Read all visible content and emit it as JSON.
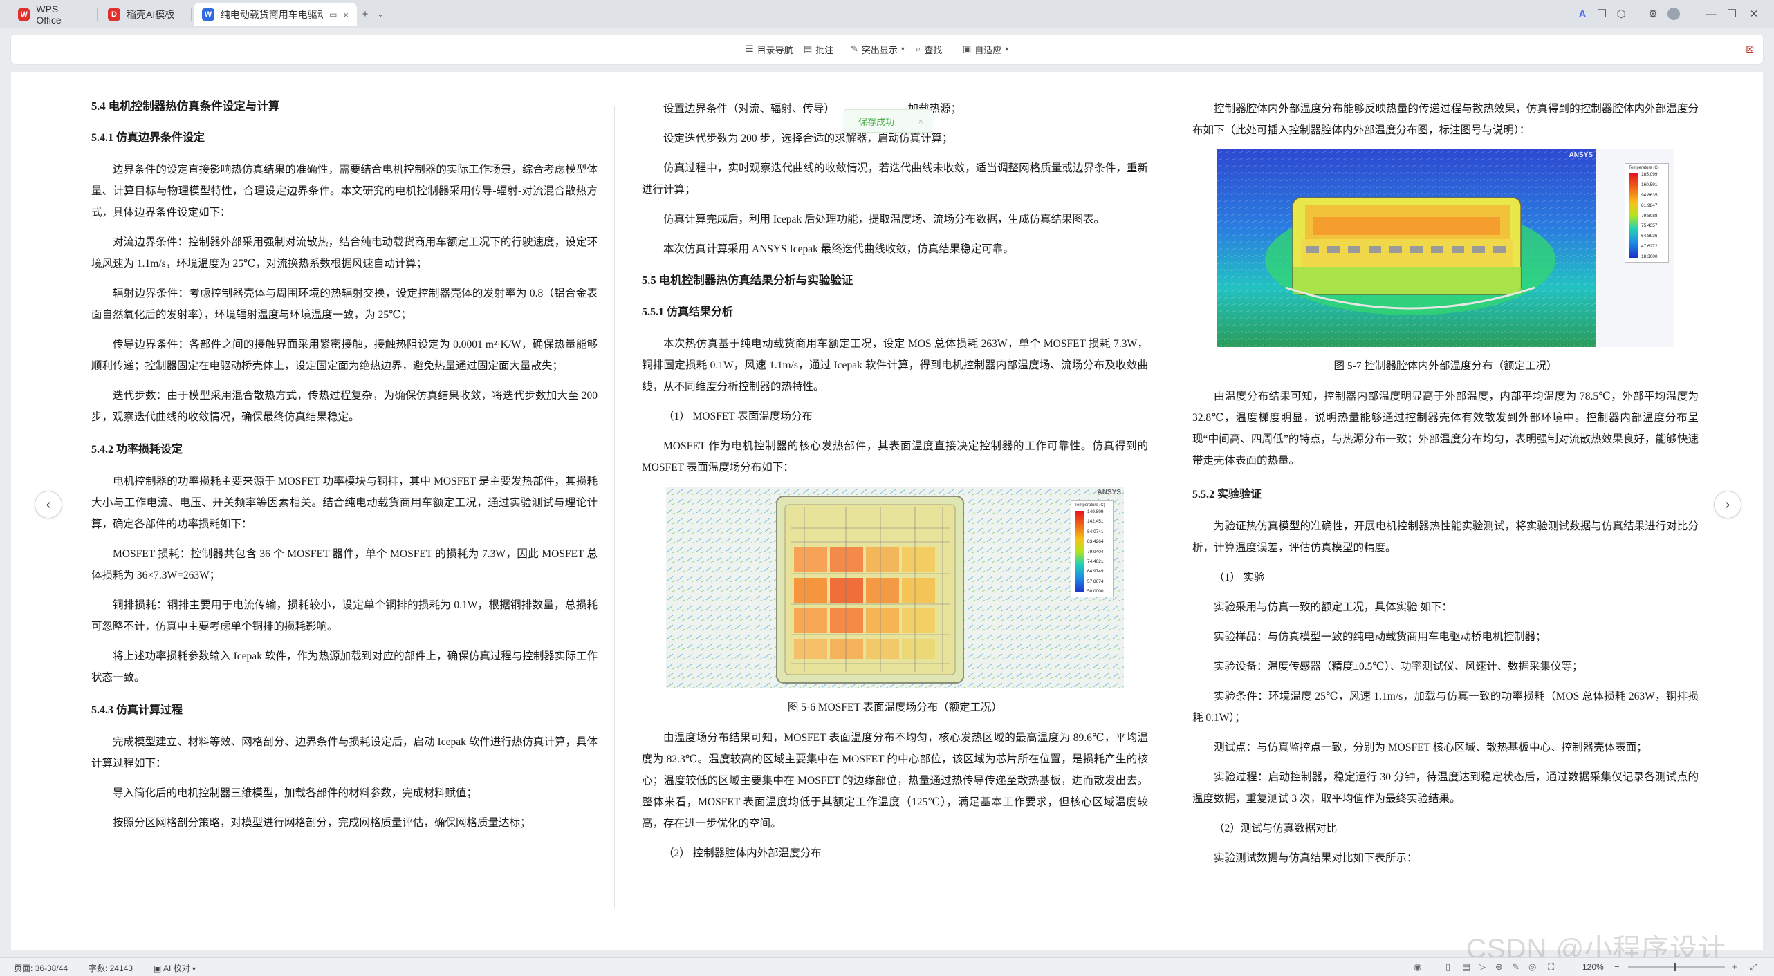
{
  "tabs": [
    {
      "label": "WPS Office",
      "logo": "W",
      "logo_color": "#e0302e"
    },
    {
      "label": "稻壳AI模板",
      "logo": "D",
      "logo_color": "#e0302e"
    },
    {
      "label": "纯电动载货商用车电驱动桥",
      "logo": "W",
      "logo_color": "#2f6ae0"
    }
  ],
  "toolbar": {
    "nav": "目录导航",
    "comment": "批注",
    "highlight": "突出显示",
    "find": "查找",
    "autofit": "自适应"
  },
  "toast": {
    "text": "保存成功"
  },
  "col1": {
    "h_54": "5.4  电机控制器热仿真条件设定与计算",
    "h_541": "5.4.1  仿真边界条件设定",
    "p1": "边界条件的设定直接影响热仿真结果的准确性，需要结合电机控制器的实际工作场景，综合考虑模型体量、计算目标与物理模型特性，合理设定边界条件。本文研究的电机控制器采用传导-辐射-对流混合散热方式，具体边界条件设定如下：",
    "p2": "对流边界条件：控制器外部采用强制对流散热，结合纯电动载货商用车额定工况下的行驶速度，设定环境风速为 1.1m/s，环境温度为 25℃，对流换热系数根据风速自动计算；",
    "p3": "辐射边界条件：考虑控制器壳体与周围环境的热辐射交换，设定控制器壳体的发射率为 0.8（铝合金表面自然氧化后的发射率），环境辐射温度与环境温度一致，为 25℃；",
    "p4": "传导边界条件：各部件之间的接触界面采用紧密接触，接触热阻设定为 0.0001 m²·K/W，确保热量能够顺利传递；控制器固定在电驱动桥壳体上，设定固定面为绝热边界，避免热量通过固定面大量散失；",
    "p5": "迭代步数：由于模型采用混合散热方式，传热过程复杂，为确保仿真结果收敛，将迭代步数加大至 200 步，观察迭代曲线的收敛情况，确保最终仿真结果稳定。",
    "h_542": "5.4.2  功率损耗设定",
    "p6": "电机控制器的功率损耗主要来源于 MOSFET 功率模块与铜排，其中 MOSFET 是主要发热部件，其损耗大小与工作电流、电压、开关频率等因素相关。结合纯电动载货商用车额定工况，通过实验测试与理论计算，确定各部件的功率损耗如下：",
    "p7": "MOSFET 损耗：控制器共包含 36 个 MOSFET 器件，单个 MOSFET 的损耗为 7.3W，因此 MOSFET 总体损耗为 36×7.3W=263W；",
    "p8": "铜排损耗：铜排主要用于电流传输，损耗较小，设定单个铜排的损耗为 0.1W，根据铜排数量，总损耗可忽略不计，仿真中主要考虑单个铜排的损耗影响。",
    "p9": "将上述功率损耗参数输入 Icepak 软件，作为热源加载到对应的部件上，确保仿真过程与控制器实际工作状态一致。",
    "h_543": "5.4.3  仿真计算过程",
    "p10": "完成模型建立、材料等效、网格剖分、边界条件与损耗设定后，启动 Icepak 软件进行热仿真计算，具体计算过程如下：",
    "p11": "导入简化后的电机控制器三维模型，加载各部件的材料参数，完成材料赋值；",
    "p12": "按照分区网格剖分策略，对模型进行网格剖分，完成网格质量评估，确保网格质量达标；"
  },
  "col2": {
    "p1a": "设置边界条件（对流、辐射、传导）",
    "p1b": "，加载热源；",
    "p2": "设定迭代步数为 200 步，选择合适的求解器，启动仿真计算；",
    "p3": "仿真过程中，实时观察迭代曲线的收敛情况，若迭代曲线未收敛，适当调整网格质量或边界条件，重新进行计算；",
    "p4": "仿真计算完成后，利用 Icepak 后处理功能，提取温度场、流场分布数据，生成仿真结果图表。",
    "p5": "本次仿真计算采用 ANSYS Icepak 最终迭代曲线收敛，仿真结果稳定可靠。",
    "h_55": "5.5  电机控制器热仿真结果分析与实验验证",
    "h_551": "5.5.1  仿真结果分析",
    "p6": "本次热仿真基于纯电动载货商用车额定工况，设定 MOS 总体损耗 263W，单个 MOSFET 损耗 7.3W，铜排固定损耗 0.1W，风速 1.1m/s，通过 Icepak 软件计算，得到电机控制器内部温度场、流场分布及收敛曲线，从不同维度分析控制器的热特性。",
    "item1": "（1）  MOSFET 表面温度场分布",
    "p7": "MOSFET 作为电机控制器的核心发热部件，其表面温度直接决定控制器的工作可靠性。仿真得到的 MOSFET 表面温度场分布如下：",
    "fig6_caption": "图 5-6 MOSFET 表面温度场分布（额定工况）",
    "p8": "由温度场分布结果可知，MOSFET 表面温度分布不均匀，核心发热区域的最高温度为 89.6℃，平均温度为 82.3℃。温度较高的区域主要集中在 MOSFET 的中心部位，该区域为芯片所在位置，是损耗产生的核心；温度较低的区域主要集中在 MOSFET 的边缘部位，热量通过热传导传递至散热基板，进而散发出去。整体来看，MOSFET 表面温度均低于其额定工作温度（125℃），满足基本工作要求，但核心区域温度较高，存在进一步优化的空间。",
    "item2": "（2）  控制器腔体内外部温度分布"
  },
  "col3": {
    "p1": "控制器腔体内外部温度分布能够反映热量的传递过程与散热效果，仿真得到的控制器腔体内外部温度分布如下（此处可插入控制器腔体内外部温度分布图，标注图号与说明）：",
    "fig7_caption": "图 5-7  控制器腔体内外部温度分布（额定工况）",
    "p2": "由温度分布结果可知，控制器内部温度明显高于外部温度，内部平均温度为 78.5℃，外部平均温度为 32.8℃，温度梯度明显，说明热量能够通过控制器壳体有效散发到外部环境中。控制器内部温度分布呈现“中间高、四周低”的特点，与热源分布一致；外部温度分布均匀，表明强制对流散热效果良好，能够快速带走壳体表面的热量。",
    "h_552": "5.5.2  实验验证",
    "p3": "为验证热仿真模型的准确性，开展电机控制器热性能实验测试，将实验测试数据与仿真结果进行对比分析，计算温度误差，评估仿真模型的精度。",
    "item1": "（1）  实验",
    "p4": "实验采用与仿真一致的额定工况，具体实验 如下：",
    "p5": "实验样品：与仿真模型一致的纯电动载货商用车电驱动桥电机控制器；",
    "p6": "实验设备：温度传感器（精度±0.5℃）、功率测试仪、风速计、数据采集仪等；",
    "p7": "实验条件：环境温度 25℃，风速 1.1m/s，加载与仿真一致的功率损耗（MOS 总体损耗 263W，铜排损耗 0.1W）；",
    "p8": "测试点：与仿真监控点一致，分别为 MOSFET 核心区域、散热基板中心、控制器壳体表面；",
    "p9": "实验过程：启动控制器，稳定运行 30 分钟，待温度达到稳定状态后，通过数据采集仪记录各测试点的温度数据，重复测试 3 次，取平均值作为最终实验结果。",
    "item2": "（2）测试与仿真数据对比",
    "p10": "实验测试数据与仿真结果对比如下表所示："
  },
  "fig6_legend": {
    "title": "Temperature (C)",
    "values": [
      "149.899",
      "142.451",
      "84.0741",
      "83.4264",
      "79.9404",
      "74.4621",
      "64.9749",
      "57.8674",
      "50.0000"
    ]
  },
  "fig7_legend": {
    "title": "Temperature (C)",
    "values": [
      "185.099",
      "160.591",
      "94.8635",
      "81.9847",
      "79.8088",
      "75.4357",
      "64.8936",
      "47.6272",
      "18.3000"
    ]
  },
  "ansys_label": "ANSYS",
  "status": {
    "page": "页面: 36-38/44",
    "words": "字数: 24143",
    "proof": "AI 校对",
    "zoom": "120%"
  },
  "watermark": "CSDN @小程序设计"
}
